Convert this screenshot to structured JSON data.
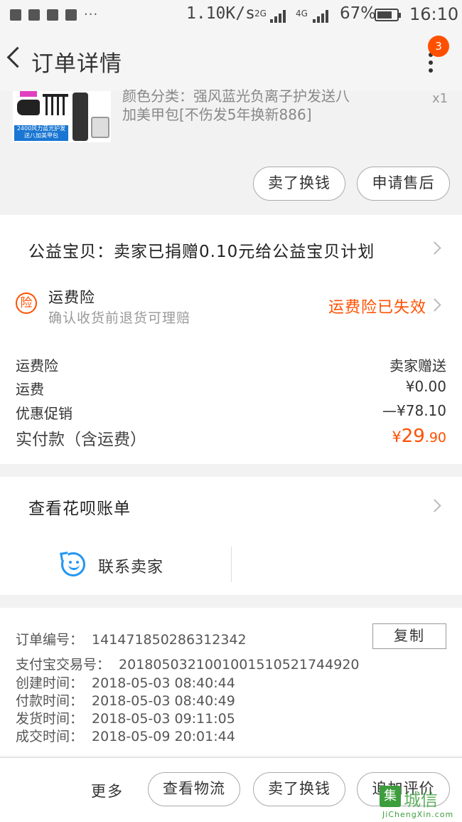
{
  "status_bar": {
    "speed": "1.10K/s",
    "net1": "2G",
    "net2": "4G",
    "battery": "67%",
    "time": "16:10",
    "more": "···"
  },
  "header": {
    "title": "订单详情",
    "badge_count": "3"
  },
  "product": {
    "text_line1": "颜色分类：强风蓝光负离子护发送八",
    "text_line2": "加美甲包[不伤发5年换新886]",
    "qty": "x1",
    "thumb_label": "2400风力蓝光护发送八加美甲包",
    "actions": [
      "卖了换钱",
      "申请售后"
    ]
  },
  "charity": {
    "text": "公益宝贝：卖家已捐赠0.10元给公益宝贝计划"
  },
  "insurance": {
    "icon_char": "险",
    "title": "运费险",
    "subtitle": "确认收货前退货可理赔",
    "status": "运费险已失效",
    "status_color": "#ff5000"
  },
  "fees": [
    {
      "label": "运费险",
      "value": "卖家赠送"
    },
    {
      "label": "运费",
      "value": "¥0.00"
    },
    {
      "label": "优惠促销",
      "value": "—¥78.10"
    }
  ],
  "total": {
    "label": "实付款（含运费）",
    "currency": "¥",
    "integer": "29",
    "decimal": ".90",
    "color": "#ff5000"
  },
  "huabei": {
    "label": "查看花呗账单"
  },
  "contact": {
    "label": "联系卖家"
  },
  "order_info": {
    "order_no_label": "订单编号：",
    "order_no": "141471850286312342",
    "copy_label": "复制",
    "alipay_label": "支付宝交易号：",
    "alipay_no": "2018050321001001510521744920",
    "created_label": "创建时间：",
    "created": "2018-05-03 08:40:44",
    "paid_label": "付款时间：",
    "paid": "2018-05-03 08:40:49",
    "shipped_label": "发货时间：",
    "shipped": "2018-05-03 09:11:05",
    "closed_label": "成交时间：",
    "closed": "2018-05-09 20:01:44"
  },
  "bottom_bar": {
    "more": "更多",
    "buttons": [
      "查看物流",
      "卖了换钱",
      "追加评价"
    ]
  },
  "watermark": {
    "char": "集",
    "text": "城信",
    "sub": "JiChengXin.com"
  }
}
